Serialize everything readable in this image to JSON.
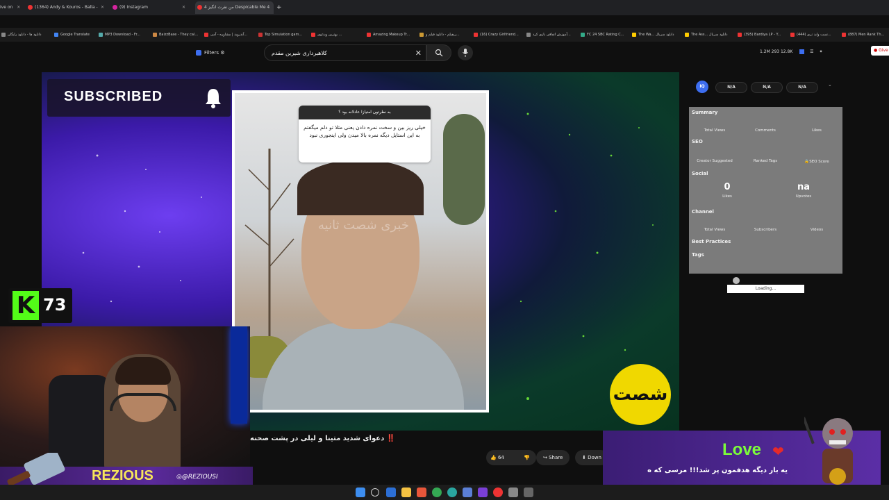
{
  "tabs": [
    {
      "label": "ive on",
      "color": "#e33"
    },
    {
      "label": "(1364) Andy & Kouros - Balla -",
      "color": "#e33"
    },
    {
      "label": "(9) Instagram",
      "color": "#d6249f"
    },
    {
      "label": "من نفرت انگیز 4 Despicable Me 4",
      "color": "#e33"
    }
  ],
  "new_tab": "+",
  "bookmarks": [
    {
      "label": "دانلود ها - دانلود رایگان",
      "color": "#888"
    },
    {
      "label": "Google Translate",
      "color": "#4285f4"
    },
    {
      "label": "MP3 Download - Fr...",
      "color": "#5aa"
    },
    {
      "label": "BaizzBase - They cal...",
      "color": "#c84"
    },
    {
      "label": "آندروید | مشاوره - آمی...",
      "color": "#e33"
    },
    {
      "label": "Top Simulation gam...",
      "color": "#c33"
    },
    {
      "label": "بهترین ویدئوی ...",
      "color": "#e33"
    },
    {
      "label": "Amazing Makeup Tr...",
      "color": "#e33"
    },
    {
      "label": "ریفیلم - دانلود فیلم و...",
      "color": "#c93"
    },
    {
      "label": "(16) Crazy Girlfriend...",
      "color": "#e33"
    },
    {
      "label": "آموزش اتفاقی بازی کرد...",
      "color": "#888"
    },
    {
      "label": "FC 24 SBC Rating C...",
      "color": "#3a8"
    },
    {
      "label": "The Wa... دانلود سریال",
      "color": "#fc0"
    },
    {
      "label": "The Ass... دانلود سریال",
      "color": "#fc0"
    },
    {
      "label": "(395) Bardiya LP - Y...",
      "color": "#e33"
    },
    {
      "label": "(444) تست واید تری...",
      "color": "#e33"
    },
    {
      "label": "(887) Men Rank Th...",
      "color": "#e33"
    }
  ],
  "topbar": {
    "filters_label": "Filters",
    "search_value": "کلاهبرداری شیرین مقدم",
    "stats": "1.2M   293   12.8K",
    "give_label": "Give"
  },
  "video": {
    "subscribed_label": "SUBSCRIBED",
    "bubble_question": "به نظرتون امتیازا عادلانه بود ؟",
    "bubble_answer": "خیلی ریز بین و سخت نمره دادن یعنی مثلا تو دلم میگفتم به این استایل دیگه نمره بالا میدن ولی اینجوری نبود",
    "watermark": "خبری شصت ثانیه",
    "logo_text": "شصت",
    "title": "‼️ دعوای شدید متینا و لیلی در پشت صحنه",
    "like_count": "64",
    "share_label": "Share",
    "download_label": "Down"
  },
  "panel": {
    "logo": "IQ",
    "pills": [
      "N/A",
      "N/A",
      "N/A"
    ],
    "summary": "Summary",
    "total_views": "Total Views",
    "comments": "Comments",
    "likes": "Likes",
    "seo": "SEO",
    "creator_suggested": "Creator Suggested",
    "ranked_tags": "Ranked Tags",
    "seo_score": "SEO Score",
    "social": "Social",
    "social_likes_val": "0",
    "social_likes": "Likes",
    "social_upvotes_val": "na",
    "social_upvotes": "Upvotes",
    "channel": "Channel",
    "ch_total_views": "Total Views",
    "subscribers": "Subscribers",
    "videos": "Videos",
    "best_practices": "Best Practices",
    "tags": "Tags",
    "loading": "Loading..."
  },
  "stream": {
    "kick_count": "73",
    "streamer_name": "REZIOUS",
    "handle": "@REZIOUSI",
    "donation_title": "Love",
    "donation_message": "یه بار دیگه هدفمون پر شد!!! مرسی که ه"
  }
}
